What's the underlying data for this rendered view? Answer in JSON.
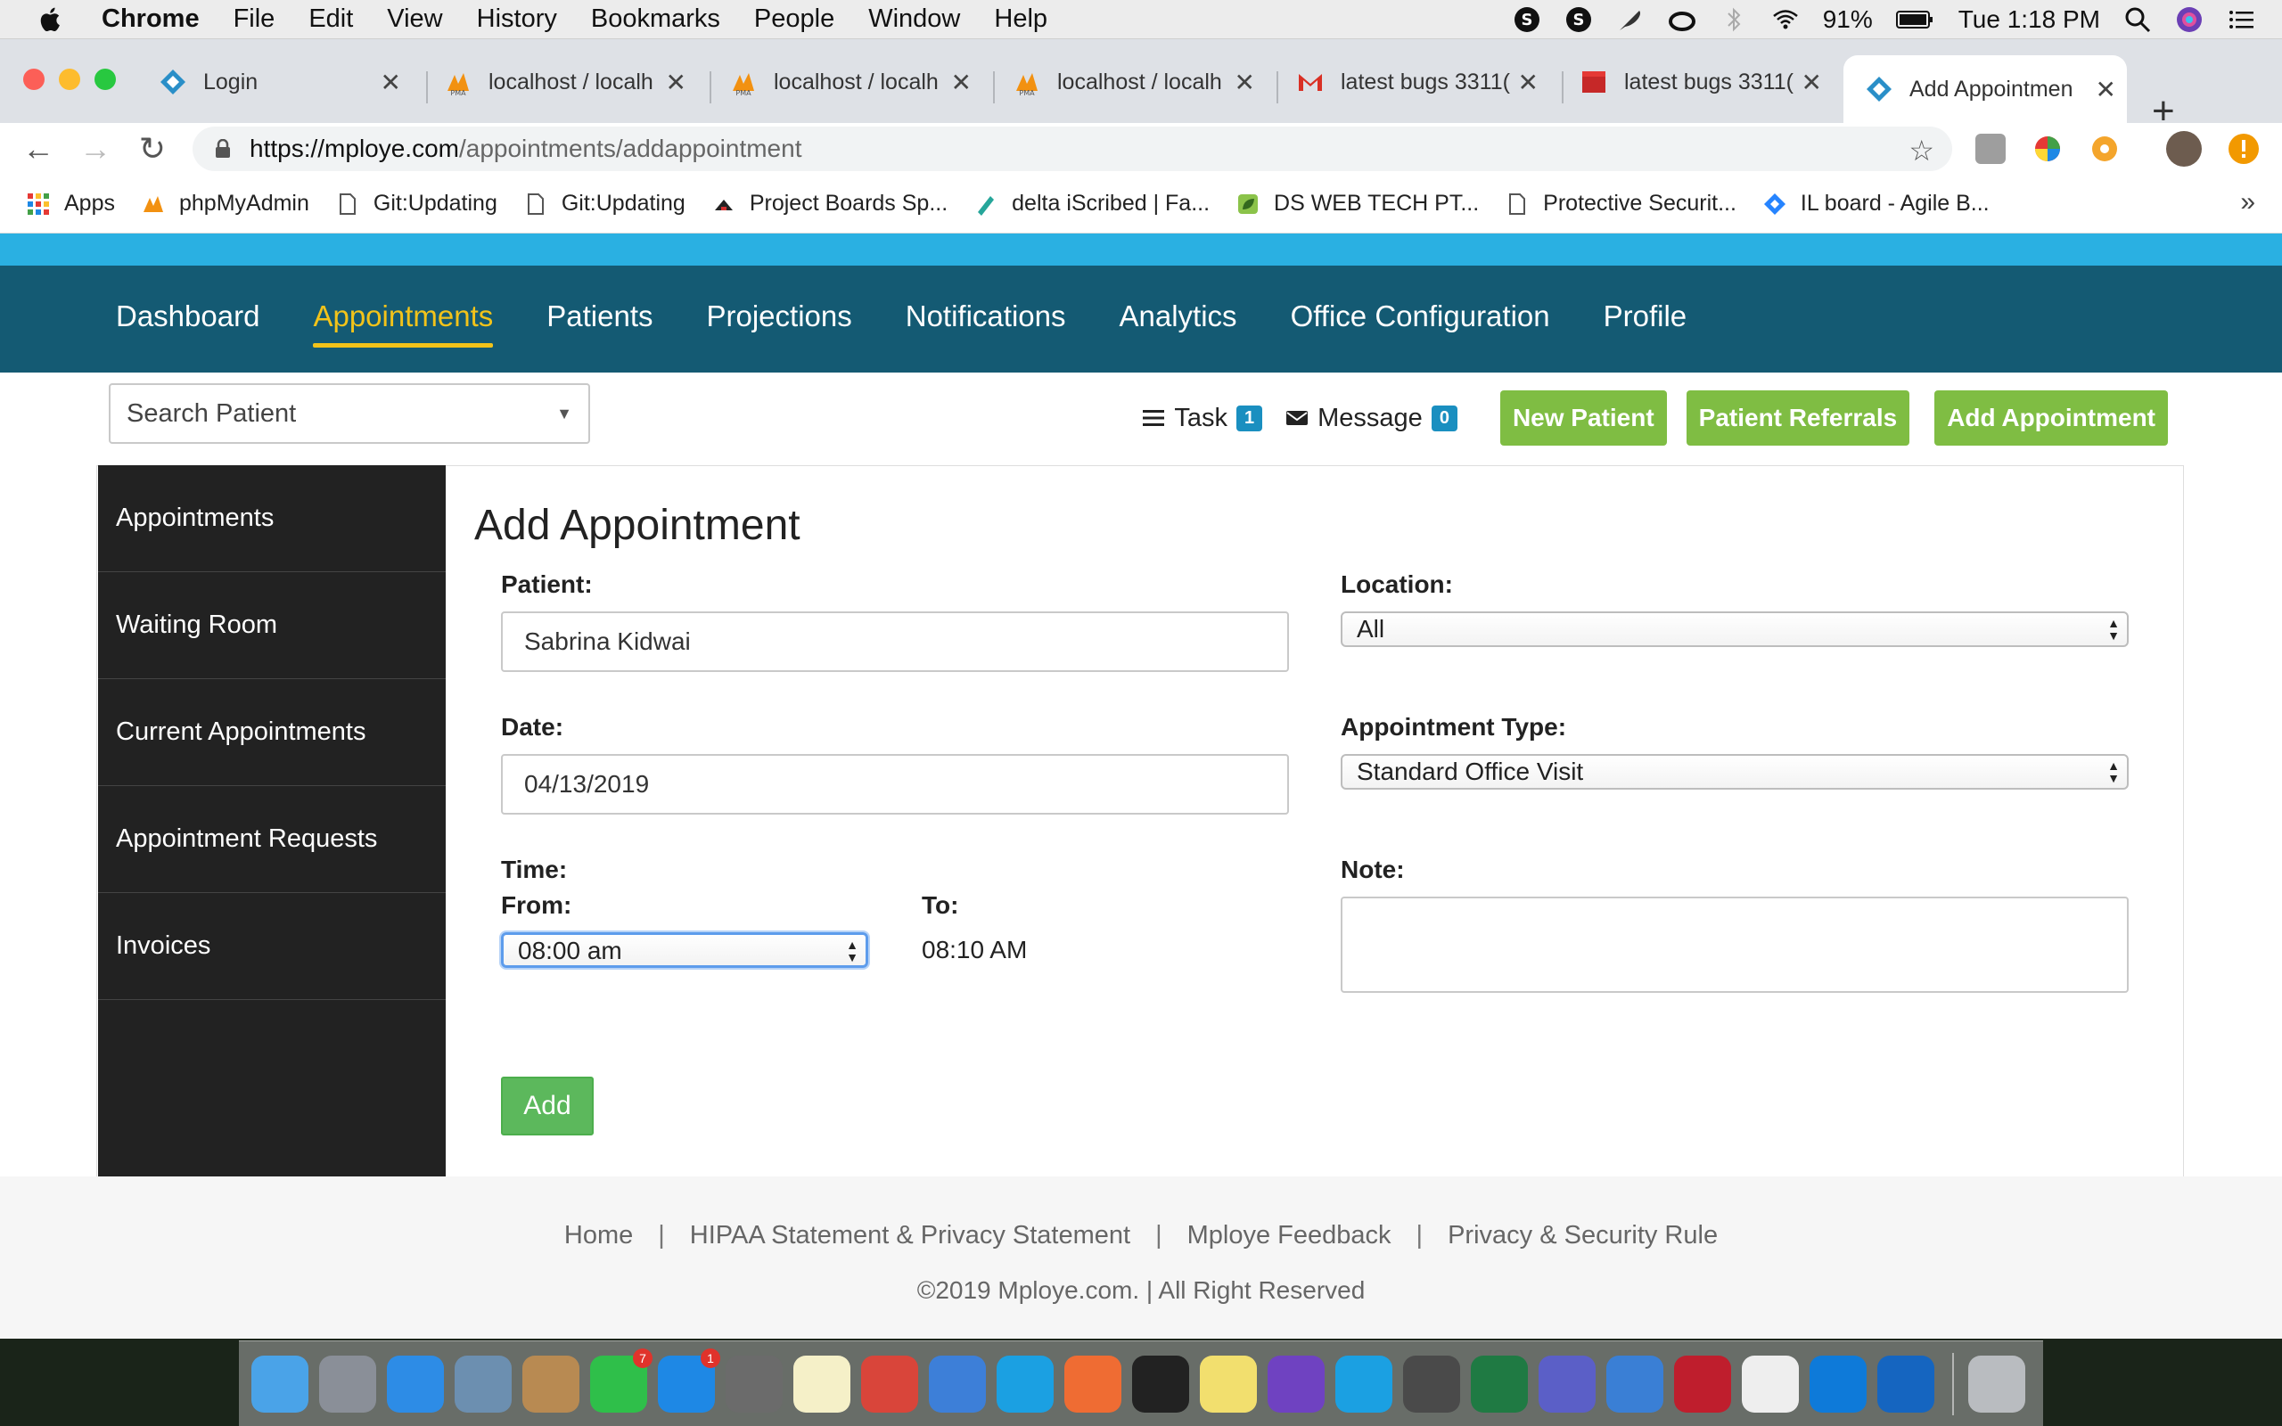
{
  "menubar": {
    "app_name": "Chrome",
    "items": [
      "File",
      "Edit",
      "View",
      "History",
      "Bookmarks",
      "People",
      "Window",
      "Help"
    ],
    "battery": "91%",
    "clock": "Tue 1:18 PM"
  },
  "browser": {
    "tabs": [
      {
        "title": "Login",
        "icon": "mploye-logo-icon"
      },
      {
        "title": "localhost / localh",
        "icon": "phpmyadmin-icon"
      },
      {
        "title": "localhost / localh",
        "icon": "phpmyadmin-icon"
      },
      {
        "title": "localhost / localh",
        "icon": "phpmyadmin-icon"
      },
      {
        "title": "latest bugs 3311(",
        "icon": "gmail-icon"
      },
      {
        "title": "latest bugs 3311(",
        "icon": "clapper-icon"
      },
      {
        "title": "Add Appointmen",
        "icon": "mploye-logo-icon"
      }
    ],
    "url_host": "https://mploye.com",
    "url_path": "/appointments/addappointment",
    "bookmarks": [
      {
        "label": "Apps",
        "icon": "apps-grid-icon"
      },
      {
        "label": "phpMyAdmin",
        "icon": "phpmyadmin-icon"
      },
      {
        "label": "Git:Updating",
        "icon": "page-icon"
      },
      {
        "label": "Git:Updating",
        "icon": "page-icon"
      },
      {
        "label": "Project Boards Sp...",
        "icon": "hat-icon"
      },
      {
        "label": "delta iScribed | Fa...",
        "icon": "pen-icon"
      },
      {
        "label": "DS WEB TECH PT...",
        "icon": "leaf-icon"
      },
      {
        "label": "Protective Securit...",
        "icon": "page-icon"
      },
      {
        "label": "IL board - Agile B...",
        "icon": "jira-icon"
      }
    ],
    "bookmarks_more": "»"
  },
  "nav": {
    "items": [
      "Dashboard",
      "Appointments",
      "Patients",
      "Projections",
      "Notifications",
      "Analytics",
      "Office Configuration",
      "Profile"
    ],
    "active_index": 1
  },
  "search_patient": "Search Patient",
  "actions": {
    "task_label": "Task",
    "task_count": "1",
    "message_label": "Message",
    "message_count": "0",
    "buttons": [
      "New Patient",
      "Patient Referrals",
      "Add Appointment"
    ]
  },
  "sidebar": {
    "items": [
      "Appointments",
      "Waiting Room",
      "Current Appointments",
      "Appointment Requests",
      "Invoices"
    ]
  },
  "form": {
    "title": "Add Appointment",
    "patient_label": "Patient:",
    "patient_value": "Sabrina Kidwai",
    "location_label": "Location:",
    "location_value": "All",
    "date_label": "Date:",
    "date_value": "04/13/2019",
    "appt_type_label": "Appointment Type:",
    "appt_type_value": "Standard Office Visit",
    "time_label": "Time:",
    "from_label": "From:",
    "from_value": "08:00 am",
    "to_label": "To:",
    "to_value": "08:10 AM",
    "note_label": "Note:",
    "note_value": "",
    "add_button": "Add"
  },
  "footer": {
    "links": [
      "Home",
      "HIPAA Statement & Privacy Statement",
      "Mploye Feedback",
      "Privacy & Security Rule"
    ],
    "separator": "|",
    "copyright": "©2019 Mploye.com. | All Right Reserved"
  },
  "dock": {
    "apps": [
      {
        "name": "finder-icon",
        "color": "#4aa3e8"
      },
      {
        "name": "launchpad-icon",
        "color": "#8a8f98"
      },
      {
        "name": "safari-icon",
        "color": "#2d8ce6"
      },
      {
        "name": "preview-icon",
        "color": "#6c8fb0"
      },
      {
        "name": "contacts-icon",
        "color": "#b88a52"
      },
      {
        "name": "whatsapp-icon",
        "color": "#2fbf4a",
        "badge": "7"
      },
      {
        "name": "app-store-icon",
        "color": "#1e88e5",
        "badge": "1"
      },
      {
        "name": "system-preferences-icon",
        "color": "#6b6b6b"
      },
      {
        "name": "notes-icon",
        "color": "#f5f0c8"
      },
      {
        "name": "chrome-icon",
        "color": "#d9453a"
      },
      {
        "name": "xcode-icon",
        "color": "#3d7fd8"
      },
      {
        "name": "skype-icon",
        "color": "#1ba0e2"
      },
      {
        "name": "postman-icon",
        "color": "#ef6c33"
      },
      {
        "name": "terminal-icon",
        "color": "#222222"
      },
      {
        "name": "stickies-icon",
        "color": "#f2df6e"
      },
      {
        "name": "github-desktop-icon",
        "color": "#6f42c1"
      },
      {
        "name": "skype-icon",
        "color": "#1ba0e2"
      },
      {
        "name": "sublime-text-icon",
        "color": "#4a4a4a"
      },
      {
        "name": "excel-icon",
        "color": "#1f7a43"
      },
      {
        "name": "teams-icon",
        "color": "#5b5fc7"
      },
      {
        "name": "mail-icon",
        "color": "#3a7fd5"
      },
      {
        "name": "filezilla-icon",
        "color": "#bf1e2d"
      },
      {
        "name": "textedit-icon",
        "color": "#eeeeee"
      },
      {
        "name": "teamviewer-icon",
        "color": "#0e7ad9"
      },
      {
        "name": "outlook-icon",
        "color": "#1565c0"
      },
      {
        "name": "trash-icon",
        "color": "#b9bcc0"
      }
    ]
  },
  "colors": {
    "nav_bg": "#145a73",
    "top_strip": "#2ab0e2",
    "active_nav": "#f2c31a",
    "green_button": "#7fbd43",
    "add_button": "#5cb85c",
    "sidebar_bg": "#222222",
    "badge": "#1a8fc0"
  }
}
